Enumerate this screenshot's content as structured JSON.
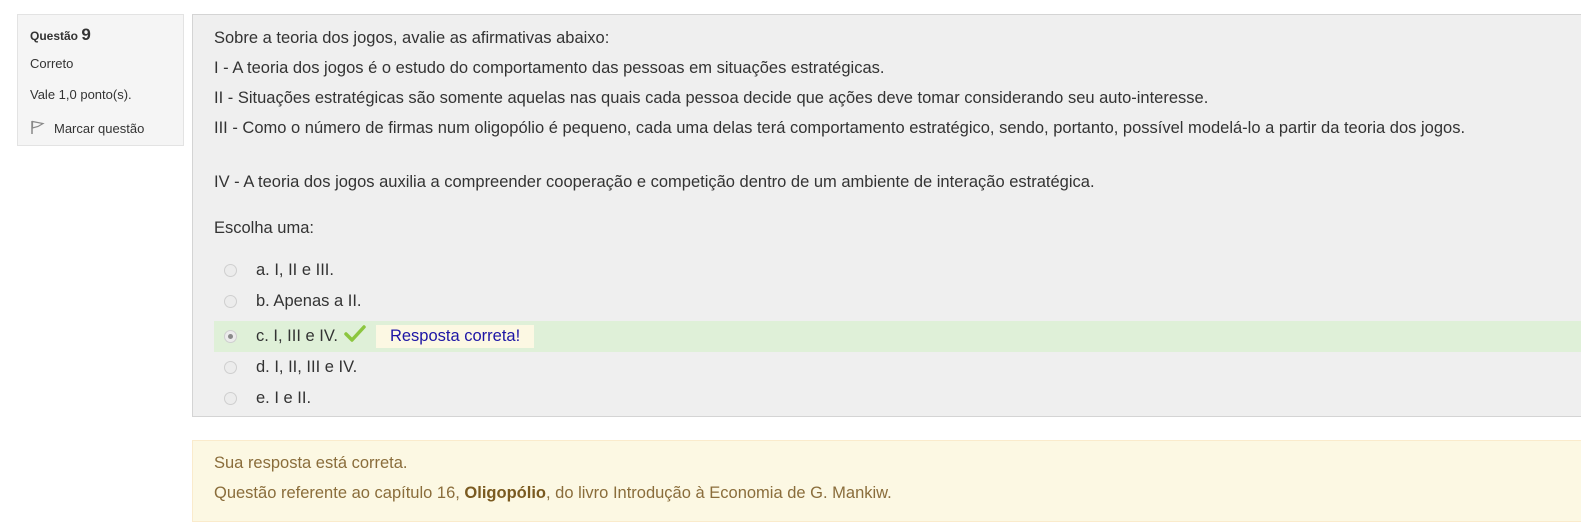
{
  "info": {
    "question_label": "Questão",
    "question_number": "9",
    "state": "Correto",
    "grade": "Vale 1,0 ponto(s).",
    "flag_label": "Marcar questão",
    "flag_icon": "flag-icon"
  },
  "question": {
    "paragraphs": [
      "Sobre a teoria dos jogos, avalie as afirmativas abaixo:",
      "I - A teoria dos jogos é o estudo do comportamento das pessoas em situações estratégicas.",
      "II - Situações estratégicas são somente aquelas nas quais cada pessoa decide que ações deve tomar considerando seu auto-interesse.",
      "III - Como o número de firmas num oligopólio é pequeno, cada uma delas terá comportamento estratégico, sendo, portanto, possível modelá-lo a partir da teoria dos jogos.",
      "IV - A teoria dos jogos auxilia a compreender cooperação e competição dentro de um ambiente de interação estratégica."
    ],
    "prompt": "Escolha uma:",
    "options": [
      {
        "label": "a. I, II e III.",
        "selected": false
      },
      {
        "label": "b. Apenas a II.",
        "selected": false
      },
      {
        "label": "c. I, III e IV.",
        "selected": true
      },
      {
        "label": "d. I, II, III e IV.",
        "selected": false
      },
      {
        "label": "e. I e II.",
        "selected": false
      }
    ],
    "inline_feedback": "Resposta correta!",
    "correct_color": "#dff0d8",
    "check_color": "#8cc63f"
  },
  "outcome": {
    "general": "Sua resposta está correta.",
    "ref_prefix": "Questão referente ao capítulo 16, ",
    "ref_bold": "Oligopólio",
    "ref_suffix": ", do livro Introdução à Economia de G. Mankiw.",
    "background": "#fcf8e3"
  }
}
